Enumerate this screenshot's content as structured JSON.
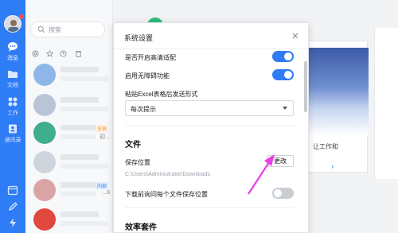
{
  "nav": {
    "items": [
      {
        "label": "消息",
        "icon": "chat-bubble-icon"
      },
      {
        "label": "文档",
        "icon": "folder-icon"
      },
      {
        "label": "工作",
        "icon": "grid-apps-icon"
      },
      {
        "label": "通讯录",
        "icon": "contacts-icon"
      }
    ],
    "bottom_icons": [
      "calendar-icon",
      "pen-icon",
      "lightning-icon"
    ],
    "accent": "#2e7cf6"
  },
  "search": {
    "placeholder": "搜索"
  },
  "list": {
    "filter_icons": [
      "mention-icon",
      "star-icon",
      "clock-icon",
      "trash-icon"
    ],
    "rows": [
      {
        "tag": "",
        "snippet": ""
      },
      {
        "tag": "",
        "snippet": ""
      },
      {
        "tag": "全员",
        "snippet": "初..."
      },
      {
        "tag": "",
        "snippet": ""
      },
      {
        "tag": "内部",
        "snippet": "...8"
      },
      {
        "tag": "",
        "snippet": ""
      }
    ]
  },
  "background": {
    "card_text": "让工作和",
    "card_arrow": "›"
  },
  "dialog": {
    "title": "系统设置",
    "options": [
      {
        "label": "是否开启高清适配",
        "enabled": true
      },
      {
        "label": "启用无障碍功能",
        "enabled": true
      }
    ],
    "paste_label": "粘贴Excel表格后发送形式",
    "paste_value": "每次提示",
    "file_section": "文件",
    "save_location_label": "保存位置",
    "save_path": "C:\\Users\\Administrator\\Downloads",
    "change_button": "更改",
    "ask_label": "下载前询问每个文件保存位置",
    "ask_enabled": false,
    "efficiency_section": "效率套件",
    "colors": {
      "toggle_on": "#2e7cf6",
      "toggle_off": "#c9ccd1",
      "annotation_arrow": "#e83fe0"
    }
  }
}
